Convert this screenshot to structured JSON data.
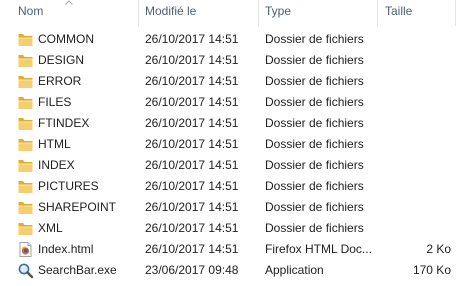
{
  "columns": {
    "name": "Nom",
    "date": "Modifié le",
    "type": "Type",
    "size": "Taille"
  },
  "rows": [
    {
      "name": "COMMON",
      "date": "26/10/2017 14:51",
      "type": "Dossier de fichiers",
      "size": "",
      "icon": "folder-icon"
    },
    {
      "name": "DESIGN",
      "date": "26/10/2017 14:51",
      "type": "Dossier de fichiers",
      "size": "",
      "icon": "folder-icon"
    },
    {
      "name": "ERROR",
      "date": "26/10/2017 14:51",
      "type": "Dossier de fichiers",
      "size": "",
      "icon": "folder-icon"
    },
    {
      "name": "FILES",
      "date": "26/10/2017 14:51",
      "type": "Dossier de fichiers",
      "size": "",
      "icon": "folder-icon"
    },
    {
      "name": "FTINDEX",
      "date": "26/10/2017 14:51",
      "type": "Dossier de fichiers",
      "size": "",
      "icon": "folder-icon"
    },
    {
      "name": "HTML",
      "date": "26/10/2017 14:51",
      "type": "Dossier de fichiers",
      "size": "",
      "icon": "folder-icon"
    },
    {
      "name": "INDEX",
      "date": "26/10/2017 14:51",
      "type": "Dossier de fichiers",
      "size": "",
      "icon": "folder-icon"
    },
    {
      "name": "PICTURES",
      "date": "26/10/2017 14:51",
      "type": "Dossier de fichiers",
      "size": "",
      "icon": "folder-icon"
    },
    {
      "name": "SHAREPOINT",
      "date": "26/10/2017 14:51",
      "type": "Dossier de fichiers",
      "size": "",
      "icon": "folder-icon"
    },
    {
      "name": "XML",
      "date": "26/10/2017 14:51",
      "type": "Dossier de fichiers",
      "size": "",
      "icon": "folder-icon"
    },
    {
      "name": "Index.html",
      "date": "26/10/2017 14:51",
      "type": "Firefox HTML Doc...",
      "size": "2 Ko",
      "icon": "firefox-html-file-icon"
    },
    {
      "name": "SearchBar.exe",
      "date": "23/06/2017 09:48",
      "type": "Application",
      "size": "170 Ko",
      "icon": "search-app-icon"
    }
  ]
}
